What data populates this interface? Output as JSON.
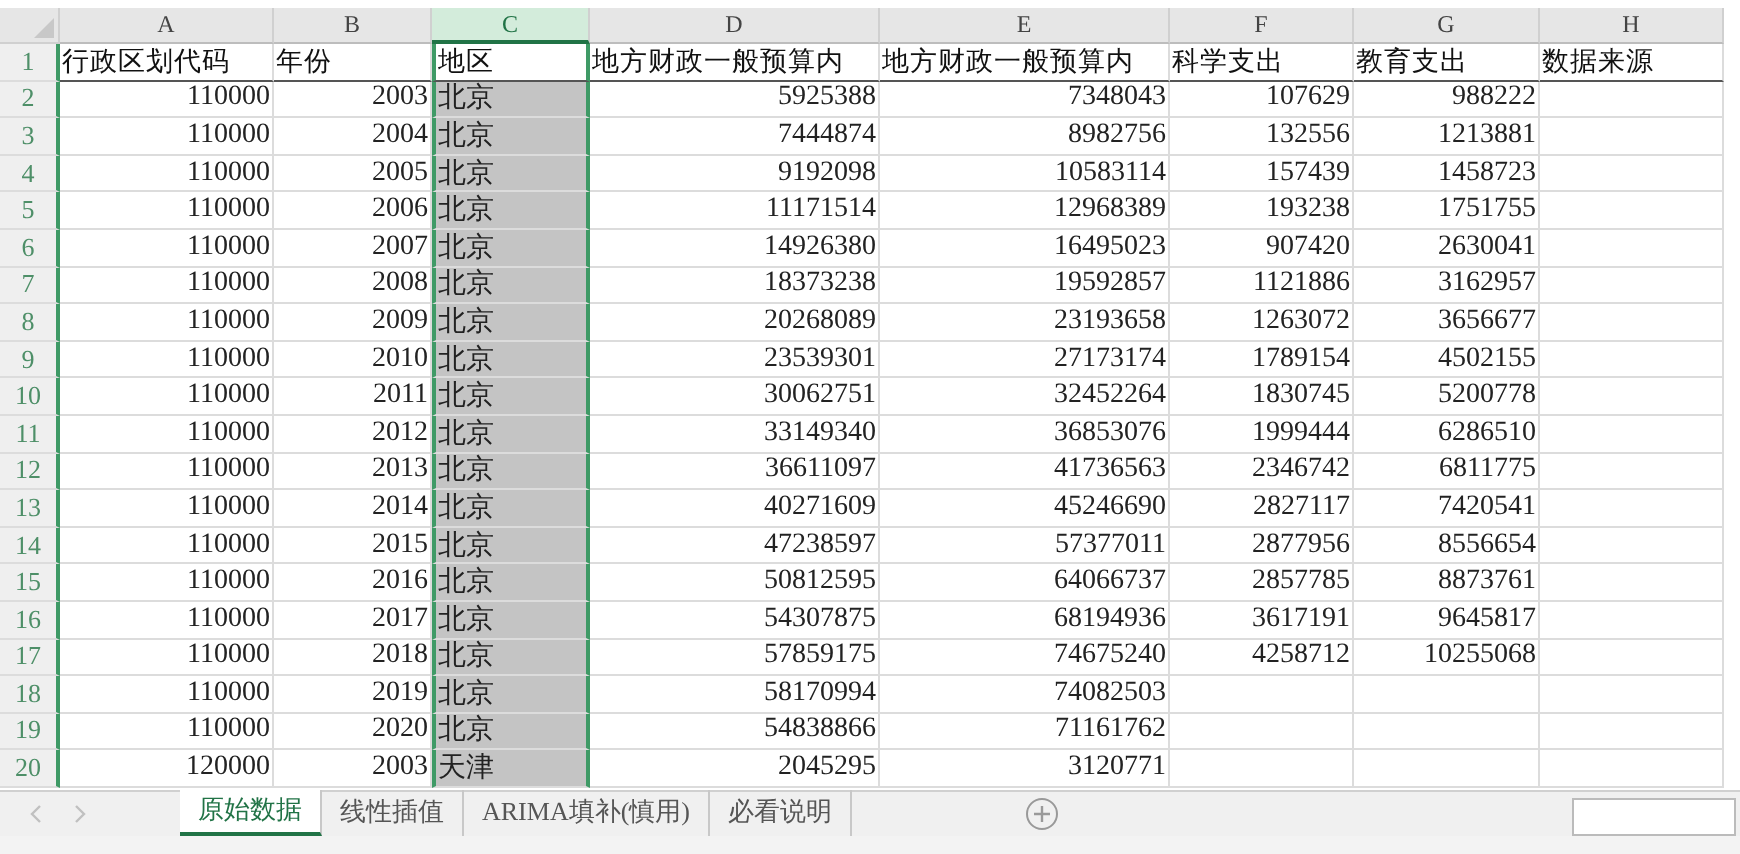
{
  "columns": [
    {
      "letter": "A",
      "kind": "number",
      "selected": false
    },
    {
      "letter": "B",
      "kind": "number",
      "selected": false
    },
    {
      "letter": "C",
      "kind": "text",
      "selected": true
    },
    {
      "letter": "D",
      "kind": "number",
      "selected": false
    },
    {
      "letter": "E",
      "kind": "number",
      "selected": false
    },
    {
      "letter": "F",
      "kind": "number",
      "selected": false
    },
    {
      "letter": "G",
      "kind": "number",
      "selected": false
    },
    {
      "letter": "H",
      "kind": "text",
      "selected": false
    }
  ],
  "rows": [
    {
      "num": "1",
      "kind": "header",
      "cells": [
        "行政区划代码",
        "年份",
        "地区",
        "地方财政一般预算内",
        "地方财政一般预算内",
        "科学支出",
        "教育支出",
        "数据来源"
      ]
    },
    {
      "num": "2",
      "kind": "data",
      "cells": [
        "110000",
        "2003",
        "北京",
        "5925388",
        "7348043",
        "107629",
        "988222"
      ]
    },
    {
      "num": "3",
      "kind": "data",
      "cells": [
        "110000",
        "2004",
        "北京",
        "7444874",
        "8982756",
        "132556",
        "1213881"
      ]
    },
    {
      "num": "4",
      "kind": "data",
      "cells": [
        "110000",
        "2005",
        "北京",
        "9192098",
        "10583114",
        "157439",
        "1458723"
      ]
    },
    {
      "num": "5",
      "kind": "data",
      "cells": [
        "110000",
        "2006",
        "北京",
        "11171514",
        "12968389",
        "193238",
        "1751755"
      ]
    },
    {
      "num": "6",
      "kind": "data",
      "cells": [
        "110000",
        "2007",
        "北京",
        "14926380",
        "16495023",
        "907420",
        "2630041"
      ]
    },
    {
      "num": "7",
      "kind": "data",
      "cells": [
        "110000",
        "2008",
        "北京",
        "18373238",
        "19592857",
        "1121886",
        "3162957"
      ]
    },
    {
      "num": "8",
      "kind": "data",
      "cells": [
        "110000",
        "2009",
        "北京",
        "20268089",
        "23193658",
        "1263072",
        "3656677"
      ]
    },
    {
      "num": "9",
      "kind": "data",
      "cells": [
        "110000",
        "2010",
        "北京",
        "23539301",
        "27173174",
        "1789154",
        "4502155"
      ]
    },
    {
      "num": "10",
      "kind": "data",
      "cells": [
        "110000",
        "2011",
        "北京",
        "30062751",
        "32452264",
        "1830745",
        "5200778"
      ]
    },
    {
      "num": "11",
      "kind": "data",
      "cells": [
        "110000",
        "2012",
        "北京",
        "33149340",
        "36853076",
        "1999444",
        "6286510"
      ]
    },
    {
      "num": "12",
      "kind": "data",
      "cells": [
        "110000",
        "2013",
        "北京",
        "36611097",
        "41736563",
        "2346742",
        "6811775"
      ]
    },
    {
      "num": "13",
      "kind": "data",
      "cells": [
        "110000",
        "2014",
        "北京",
        "40271609",
        "45246690",
        "2827117",
        "7420541"
      ]
    },
    {
      "num": "14",
      "kind": "data",
      "cells": [
        "110000",
        "2015",
        "北京",
        "47238597",
        "57377011",
        "2877956",
        "8556654"
      ]
    },
    {
      "num": "15",
      "kind": "data",
      "cells": [
        "110000",
        "2016",
        "北京",
        "50812595",
        "64066737",
        "2857785",
        "8873761"
      ]
    },
    {
      "num": "16",
      "kind": "data",
      "cells": [
        "110000",
        "2017",
        "北京",
        "54307875",
        "68194936",
        "3617191",
        "9645817"
      ]
    },
    {
      "num": "17",
      "kind": "data",
      "cells": [
        "110000",
        "2018",
        "北京",
        "57859175",
        "74675240",
        "4258712",
        "10255068"
      ]
    },
    {
      "num": "18",
      "kind": "data",
      "cells": [
        "110000",
        "2019",
        "北京",
        "58170994",
        "74082503"
      ]
    },
    {
      "num": "19",
      "kind": "data",
      "cells": [
        "110000",
        "2020",
        "北京",
        "54838866",
        "71161762"
      ]
    },
    {
      "num": "20",
      "kind": "data",
      "cells": [
        "120000",
        "2003",
        "天津",
        "2045295",
        "3120771"
      ]
    }
  ],
  "sheet_tabs": [
    {
      "label": "原始数据",
      "selected": true
    },
    {
      "label": "线性插值",
      "selected": false
    },
    {
      "label": "ARIMA填补(慎用)",
      "selected": false
    },
    {
      "label": "必看说明",
      "selected": false
    }
  ]
}
